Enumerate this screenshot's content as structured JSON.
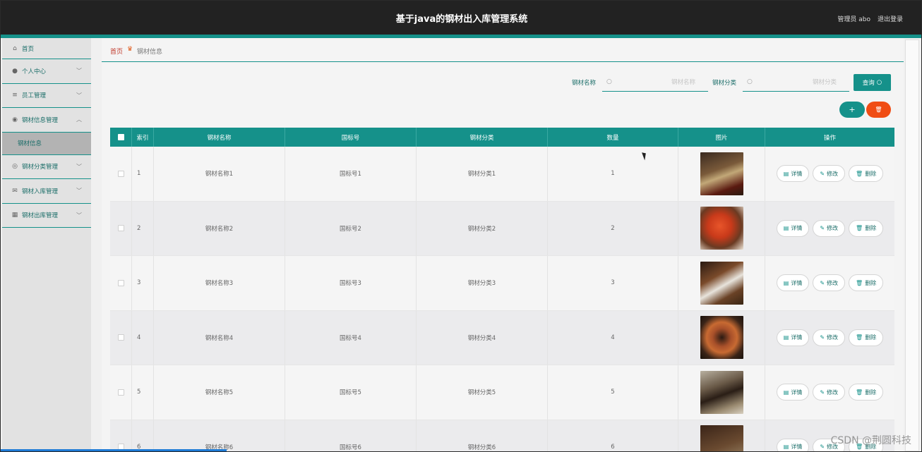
{
  "header": {
    "title": "基于java的钢材出入库管理系统",
    "admin_label": "管理员 abo",
    "logout_label": "退出登录"
  },
  "sidebar": {
    "items": [
      {
        "label": "首页",
        "icon": "home-icon",
        "has_chevron": false
      },
      {
        "label": "个人中心",
        "icon": "user-icon",
        "has_chevron": true
      },
      {
        "label": "员工管理",
        "icon": "list-icon",
        "has_chevron": true
      },
      {
        "label": "钢材信息管理",
        "icon": "location-icon",
        "has_chevron": true,
        "expanded": true
      },
      {
        "label": "钢材分类管理",
        "icon": "settings-icon",
        "has_chevron": true
      },
      {
        "label": "钢材入库管理",
        "icon": "mail-icon",
        "has_chevron": true
      },
      {
        "label": "钢材出库管理",
        "icon": "grid-icon",
        "has_chevron": true
      }
    ],
    "active_subitem": "钢材信息"
  },
  "breadcrumb": {
    "home": "首页",
    "current": "钢材信息"
  },
  "search": {
    "name_label": "钢材名称",
    "name_placeholder": "钢材名称",
    "category_label": "钢材分类",
    "category_placeholder": "钢材分类",
    "query_button": "查询"
  },
  "toolbar": {
    "add_icon": "plus-icon",
    "delete_icon": "trash-icon"
  },
  "table": {
    "headers": [
      "索引",
      "钢材名称",
      "国标号",
      "钢材分类",
      "数量",
      "图片",
      "操作"
    ],
    "rows": [
      {
        "index": "1",
        "name": "钢材名称1",
        "standard": "国标号1",
        "category": "钢材分类1",
        "quantity": "1"
      },
      {
        "index": "2",
        "name": "钢材名称2",
        "standard": "国标号2",
        "category": "钢材分类2",
        "quantity": "2"
      },
      {
        "index": "3",
        "name": "钢材名称3",
        "standard": "国标号3",
        "category": "钢材分类3",
        "quantity": "3"
      },
      {
        "index": "4",
        "name": "钢材名称4",
        "standard": "国标号4",
        "category": "钢材分类4",
        "quantity": "4"
      },
      {
        "index": "5",
        "name": "钢材名称5",
        "standard": "国标号5",
        "category": "钢材分类5",
        "quantity": "5"
      },
      {
        "index": "6",
        "name": "钢材名称6",
        "standard": "国标号6",
        "category": "钢材分类6",
        "quantity": "6"
      }
    ],
    "actions": {
      "detail": "详情",
      "edit": "修改",
      "delete": "删除"
    }
  },
  "watermark": "CSDN @荆圆科技",
  "colors": {
    "accent": "#15918a",
    "danger": "#f04d14",
    "topbar": "#222222"
  }
}
